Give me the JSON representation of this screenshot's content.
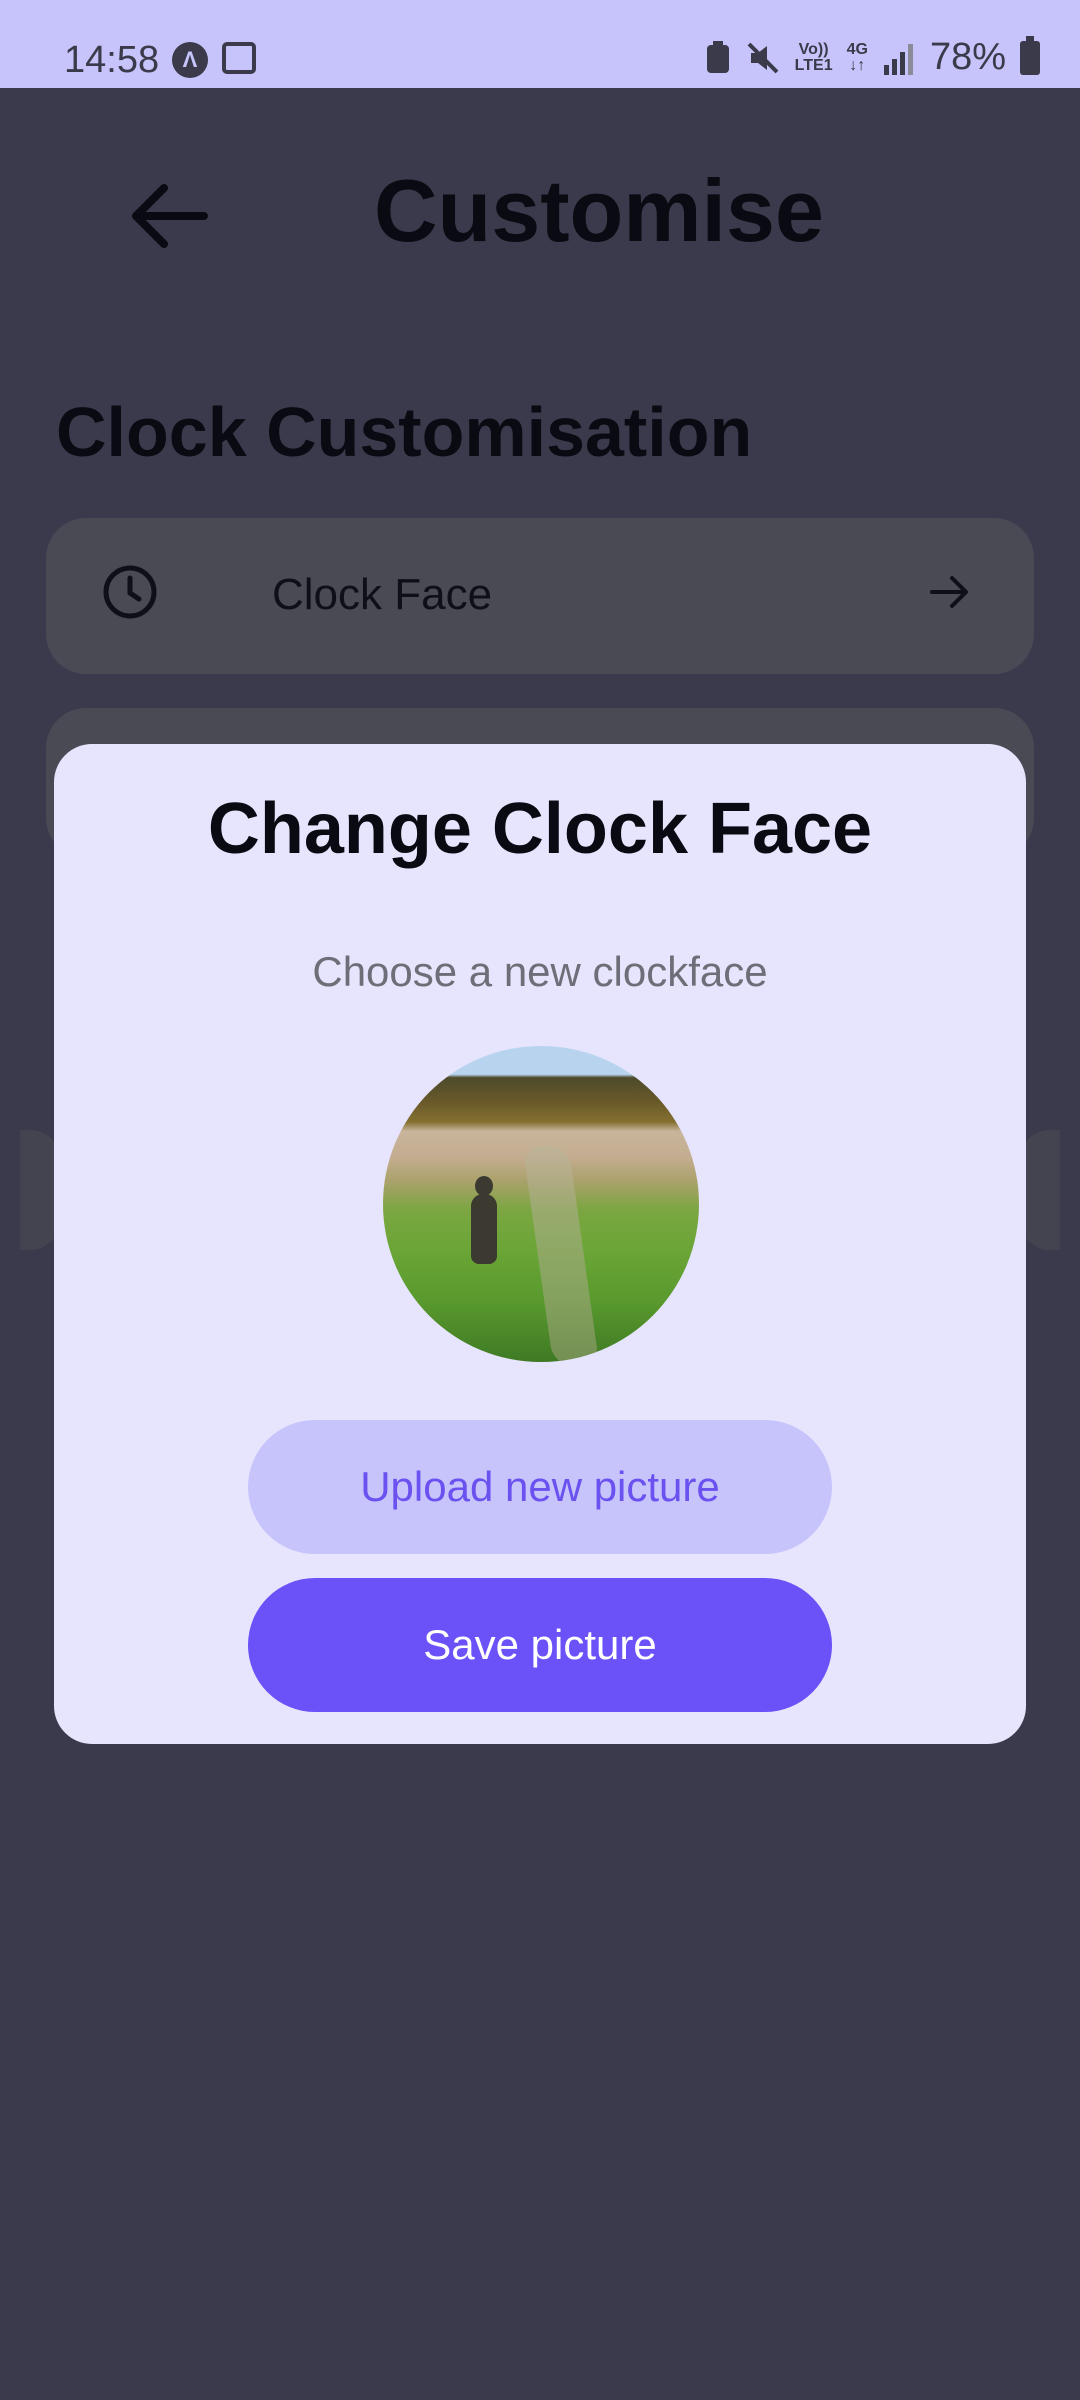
{
  "status_bar": {
    "time": "14:58",
    "signal_label_top": "Vo))",
    "signal_label_bottom": "LTE1",
    "network": "4G",
    "battery": "78%"
  },
  "header": {
    "title": "Customise"
  },
  "section": {
    "title": "Clock Customisation"
  },
  "cards": [
    {
      "label": "Clock Face",
      "icon": "clock-icon"
    }
  ],
  "dialog": {
    "title": "Change Clock Face",
    "subtitle": "Choose a new clockface",
    "upload_label": "Upload new picture",
    "save_label": "Save picture"
  },
  "colors": {
    "status_bar": "#c6c4fb",
    "scrim_background": "#3b3a4c",
    "dialog_background": "#e6e5fd",
    "accent": "#6a51f8",
    "accent_light": "#c6c4fb"
  }
}
